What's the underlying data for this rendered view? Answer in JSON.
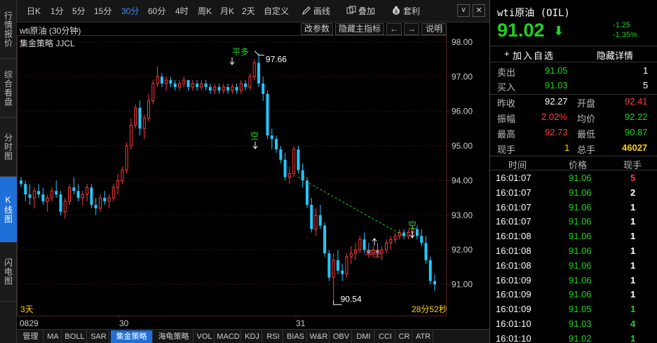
{
  "leftnav": [
    {
      "label": "行情报价",
      "active": false
    },
    {
      "label": "综合看盘",
      "active": false
    },
    {
      "label": "分时图",
      "active": false
    },
    {
      "label": "K线图",
      "active": true
    },
    {
      "label": "闪电图",
      "active": false
    }
  ],
  "toolbar": {
    "periods": [
      "日K",
      "1分",
      "5分",
      "15分",
      "30分",
      "60分",
      "4时",
      "周K",
      "月K",
      "2天",
      "自定义"
    ],
    "active_period": "30分",
    "draw_label": "画线",
    "overlay_label": "叠加",
    "arbitrage_label": "套利"
  },
  "chart": {
    "title": "wti原油 (30分钟)",
    "strategy": "集金策略 JJCL",
    "buttons": [
      "改参数",
      "隐藏主指标",
      "←",
      "→",
      "说明"
    ],
    "period_label": "3天",
    "countdown": "28分52秒",
    "signals": {
      "buy_open": "平多",
      "short": "空",
      "close_short": "平空"
    },
    "high_label": "97.66",
    "low_label": "90.54"
  },
  "chart_data": {
    "type": "candlestick",
    "ylim": [
      90.1,
      98.2
    ],
    "yticks": [
      "98.00",
      "97.00",
      "96.00",
      "95.00",
      "94.00",
      "93.00",
      "92.00",
      "91.00"
    ],
    "xlabels": [
      "0829",
      "30",
      "31"
    ],
    "candles": [
      [
        94.0,
        94.1,
        93.8,
        93.9
      ],
      [
        93.9,
        94.0,
        93.4,
        93.6
      ],
      [
        93.6,
        93.9,
        93.3,
        93.5
      ],
      [
        93.5,
        93.8,
        93.2,
        93.7
      ],
      [
        93.7,
        93.9,
        93.5,
        93.6
      ],
      [
        93.6,
        93.8,
        93.3,
        93.4
      ],
      [
        93.4,
        93.6,
        93.1,
        93.5
      ],
      [
        93.5,
        93.8,
        93.4,
        93.7
      ],
      [
        93.7,
        94.0,
        93.5,
        93.6
      ],
      [
        93.6,
        93.7,
        93.0,
        93.1
      ],
      [
        93.1,
        93.5,
        92.9,
        93.4
      ],
      [
        93.4,
        93.9,
        93.3,
        93.8
      ],
      [
        93.8,
        94.1,
        93.6,
        93.7
      ],
      [
        93.7,
        93.9,
        93.4,
        93.5
      ],
      [
        93.5,
        93.7,
        93.3,
        93.6
      ],
      [
        93.6,
        93.9,
        93.4,
        93.8
      ],
      [
        93.8,
        93.9,
        93.2,
        93.3
      ],
      [
        93.3,
        93.5,
        93.0,
        93.2
      ],
      [
        93.2,
        93.6,
        93.1,
        93.5
      ],
      [
        93.5,
        93.7,
        93.3,
        93.4
      ],
      [
        93.4,
        93.6,
        93.2,
        93.5
      ],
      [
        93.5,
        93.9,
        93.4,
        93.8
      ],
      [
        93.8,
        94.2,
        93.6,
        94.0
      ],
      [
        94.0,
        94.4,
        93.9,
        94.3
      ],
      [
        94.3,
        95.1,
        94.2,
        95.0
      ],
      [
        95.0,
        95.8,
        94.9,
        95.6
      ],
      [
        95.6,
        96.2,
        95.5,
        96.1
      ],
      [
        96.1,
        96.3,
        95.3,
        95.5
      ],
      [
        95.5,
        95.9,
        95.2,
        95.8
      ],
      [
        95.8,
        96.5,
        95.7,
        96.3
      ],
      [
        96.3,
        96.9,
        96.2,
        96.8
      ],
      [
        96.8,
        97.3,
        96.7,
        97.0
      ],
      [
        97.0,
        97.1,
        96.7,
        96.8
      ],
      [
        96.8,
        97.0,
        96.6,
        96.9
      ],
      [
        96.9,
        97.0,
        96.7,
        96.8
      ],
      [
        96.8,
        96.9,
        96.6,
        96.7
      ],
      [
        96.7,
        96.9,
        96.6,
        96.8
      ],
      [
        96.8,
        97.0,
        96.7,
        96.9
      ],
      [
        96.9,
        96.9,
        96.6,
        96.7
      ],
      [
        96.7,
        96.9,
        96.6,
        96.8
      ],
      [
        96.8,
        96.9,
        96.6,
        96.7
      ],
      [
        96.7,
        96.9,
        96.6,
        96.8
      ],
      [
        96.8,
        96.9,
        96.6,
        96.7
      ],
      [
        96.7,
        96.8,
        96.5,
        96.6
      ],
      [
        96.6,
        96.8,
        96.5,
        96.7
      ],
      [
        96.7,
        96.8,
        96.5,
        96.6
      ],
      [
        96.6,
        96.8,
        96.5,
        96.7
      ],
      [
        96.7,
        96.8,
        96.5,
        96.6
      ],
      [
        96.6,
        96.8,
        96.5,
        96.7
      ],
      [
        96.7,
        96.8,
        96.5,
        96.6
      ],
      [
        96.6,
        96.9,
        96.5,
        96.8
      ],
      [
        96.8,
        96.9,
        96.6,
        96.7
      ],
      [
        96.7,
        97.1,
        96.6,
        97.0
      ],
      [
        97.0,
        97.5,
        96.9,
        97.4
      ],
      [
        97.4,
        97.66,
        96.7,
        96.8
      ],
      [
        96.8,
        97.0,
        96.3,
        96.5
      ],
      [
        96.5,
        96.6,
        95.2,
        95.3
      ],
      [
        95.3,
        95.5,
        94.9,
        95.2
      ],
      [
        95.2,
        95.3,
        94.8,
        94.9
      ],
      [
        94.9,
        95.0,
        94.5,
        94.6
      ],
      [
        94.6,
        94.8,
        94.0,
        94.1
      ],
      [
        94.1,
        94.4,
        93.9,
        94.2
      ],
      [
        94.2,
        95.0,
        94.1,
        94.9
      ],
      [
        94.9,
        95.0,
        94.2,
        94.3
      ],
      [
        94.3,
        94.5,
        93.8,
        94.0
      ],
      [
        94.0,
        94.1,
        93.2,
        93.3
      ],
      [
        93.3,
        93.5,
        92.5,
        92.6
      ],
      [
        92.6,
        93.2,
        92.4,
        93.0
      ],
      [
        93.0,
        93.3,
        92.6,
        92.7
      ],
      [
        92.7,
        92.8,
        91.8,
        91.9
      ],
      [
        91.9,
        92.0,
        91.1,
        91.2
      ],
      [
        91.2,
        91.9,
        90.54,
        91.7
      ],
      [
        91.7,
        92.0,
        91.3,
        91.4
      ],
      [
        91.4,
        91.6,
        91.1,
        91.3
      ],
      [
        91.3,
        91.9,
        91.2,
        91.8
      ],
      [
        91.8,
        92.1,
        91.6,
        91.9
      ],
      [
        91.9,
        92.2,
        91.7,
        92.0
      ],
      [
        92.0,
        92.4,
        91.9,
        92.3
      ],
      [
        92.3,
        92.5,
        91.9,
        92.0
      ],
      [
        92.0,
        92.2,
        91.8,
        91.9
      ],
      [
        91.9,
        92.1,
        91.8,
        92.0
      ],
      [
        92.0,
        92.2,
        91.8,
        91.9
      ],
      [
        91.9,
        92.1,
        91.7,
        92.0
      ],
      [
        92.0,
        92.3,
        91.9,
        92.2
      ],
      [
        92.2,
        92.4,
        92.0,
        92.3
      ],
      [
        92.3,
        92.5,
        92.2,
        92.4
      ],
      [
        92.4,
        92.6,
        92.3,
        92.5
      ],
      [
        92.5,
        92.6,
        92.3,
        92.4
      ],
      [
        92.4,
        92.6,
        92.3,
        92.5
      ],
      [
        92.5,
        92.7,
        92.4,
        92.6
      ],
      [
        92.6,
        92.7,
        92.3,
        92.4
      ],
      [
        92.4,
        92.6,
        92.1,
        92.2
      ],
      [
        92.2,
        92.4,
        91.6,
        91.7
      ],
      [
        91.7,
        91.8,
        91.0,
        91.1
      ],
      [
        91.1,
        91.3,
        90.8,
        91.0
      ]
    ],
    "dashed_line": {
      "from_index": 63,
      "from_price": 94.1,
      "to_index": 87,
      "to_price": 92.4
    }
  },
  "quote": {
    "name": "wti原油 (OIL)",
    "price": "91.02",
    "change": "-1.25",
    "change_pct": "-1.35%",
    "add_watch": "加入自选",
    "hide_detail": "隐藏详情",
    "sell_label": "卖出",
    "sell_price": "91.05",
    "sell_qty": "1",
    "buy_label": "买入",
    "buy_price": "91.03",
    "buy_qty": "5",
    "prev_close_label": "昨收",
    "prev_close": "92.27",
    "open_label": "开盘",
    "open": "92.41",
    "amplitude_label": "振幅",
    "amplitude": "2.02%",
    "avg_label": "均价",
    "avg": "92.22",
    "high_label": "最高",
    "high": "92.73",
    "low_label": "最低",
    "low": "90.87",
    "current_vol_label": "现手",
    "current_vol": "1",
    "total_vol_label": "总手",
    "total_vol": "46027",
    "col_time": "时间",
    "col_price": "价格",
    "col_vol": "现手",
    "ticks": [
      {
        "time": "16:01:07",
        "price": "91.06",
        "vol": "5",
        "vol_color": "red"
      },
      {
        "time": "16:01:07",
        "price": "91.06",
        "vol": "2",
        "vol_color": "white"
      },
      {
        "time": "16:01:07",
        "price": "91.06",
        "vol": "1",
        "vol_color": "white"
      },
      {
        "time": "16:01:07",
        "price": "91.06",
        "vol": "1",
        "vol_color": "white"
      },
      {
        "time": "16:01:08",
        "price": "91.06",
        "vol": "1",
        "vol_color": "white"
      },
      {
        "time": "16:01:08",
        "price": "91.06",
        "vol": "1",
        "vol_color": "white"
      },
      {
        "time": "16:01:08",
        "price": "91.06",
        "vol": "1",
        "vol_color": "white"
      },
      {
        "time": "16:01:09",
        "price": "91.06",
        "vol": "1",
        "vol_color": "white"
      },
      {
        "time": "16:01:09",
        "price": "91.06",
        "vol": "1",
        "vol_color": "white"
      },
      {
        "time": "16:01:09",
        "price": "91.05",
        "vol": "1",
        "vol_color": "green"
      },
      {
        "time": "16:01:10",
        "price": "91.03",
        "vol": "4",
        "vol_color": "green"
      },
      {
        "time": "16:01:10",
        "price": "91.02",
        "vol": "1",
        "vol_color": "green"
      }
    ]
  },
  "bottomtabs": [
    "管理",
    "MA",
    "BOLL",
    "SAR",
    "集金策略",
    "海龟策略",
    "VOL",
    "MACD",
    "KDJ",
    "RSI",
    "BIAS",
    "W&R",
    "OBV",
    "DMI",
    "CCI",
    "CR",
    "ATR"
  ],
  "active_bottomtab": "集金策略",
  "colors": {
    "up": "#ff3b3b",
    "down": "#22c8ff",
    "accent": "#1f6fd8",
    "grid": "#5a2020",
    "signal": "#22d022"
  }
}
